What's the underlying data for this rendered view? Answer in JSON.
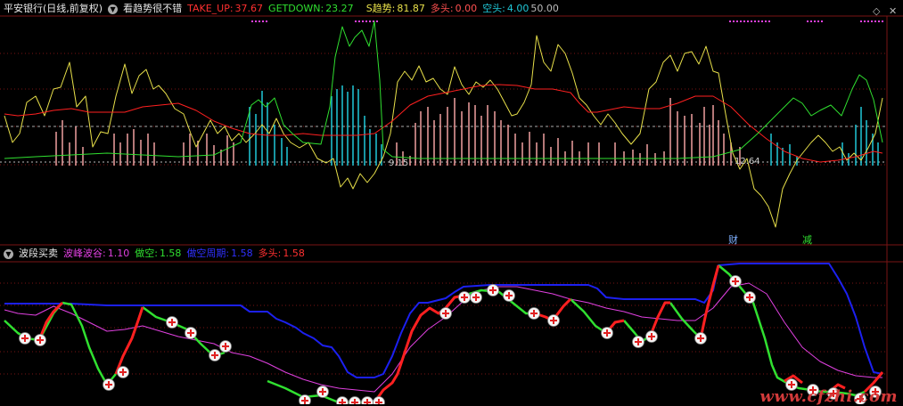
{
  "top_header": {
    "stock": "平安银行(日线,前复权)",
    "indicator": "看趋势很不错",
    "take_up_label": "TAKE_UP:",
    "take_up_value": "37.67",
    "getdown_label": "GETDOWN:",
    "getdown_value": "23.27",
    "s_trend_label": "S趋势:",
    "s_trend_value": "81.87",
    "long_label": "多头:",
    "long_value": "0.00",
    "short_label": "空头:",
    "short_value": "4.00",
    "extra_value": "50.00"
  },
  "bottom_header": {
    "indicator": "波段买卖",
    "peak_label": "波峰波谷:",
    "peak_value": "1.10",
    "short_label": "做空:",
    "short_value": "1.58",
    "cycle_label": "做空周期:",
    "cycle_value": "1.58",
    "long_label": "多头:",
    "long_value": "1.58"
  },
  "annotations": {
    "low_left": "9.15",
    "low_right": "12.64",
    "badge_cai": "财",
    "badge_jian": "减"
  },
  "watermark": "www.cfzhi.com",
  "window_controls": {
    "diamond_icon": "◇",
    "close_icon": "✕"
  },
  "colors": {
    "bg": "#000000",
    "grid": "#7a1414",
    "yellow": "#e8e04a",
    "red": "#ff2020",
    "green": "#30e030",
    "blue": "#1c20f0",
    "magenta": "#e040e0",
    "cyan": "#20c8d8",
    "pink": "#f0a0a0"
  }
}
